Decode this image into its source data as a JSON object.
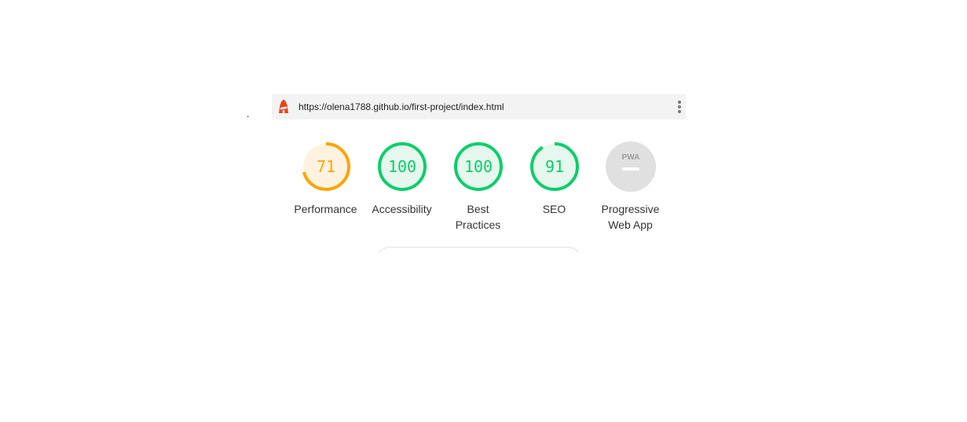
{
  "dot": ".",
  "topbar": {
    "url": "https://olena1788.github.io/first-project/index.html",
    "lighthouse_icon": "lighthouse-icon",
    "menu_icon": "vertical-dots-icon"
  },
  "gauges": [
    {
      "score": "71",
      "label_line1": "Performance",
      "label_line2": "",
      "value": 71,
      "color": "#ffa400",
      "bg": "#fff3e0"
    },
    {
      "score": "100",
      "label_line1": "Accessibility",
      "label_line2": "",
      "value": 100,
      "color": "#0cce6b",
      "bg": "#e6f7ee"
    },
    {
      "score": "100",
      "label_line1": "Best",
      "label_line2": "Practices",
      "value": 100,
      "color": "#0cce6b",
      "bg": "#e6f7ee"
    },
    {
      "score": "91",
      "label_line1": "SEO",
      "label_line2": "",
      "value": 91,
      "color": "#0cce6b",
      "bg": "#e6f7ee"
    },
    {
      "score": "PWA",
      "label_line1": "Progressive",
      "label_line2": "Web App",
      "value": null,
      "color": "#9e9e9e",
      "bg": "#e0e0e0"
    }
  ],
  "colors": {
    "pass": "#0cce6b",
    "average": "#ffa400",
    "neutral": "#e0e0e0"
  }
}
